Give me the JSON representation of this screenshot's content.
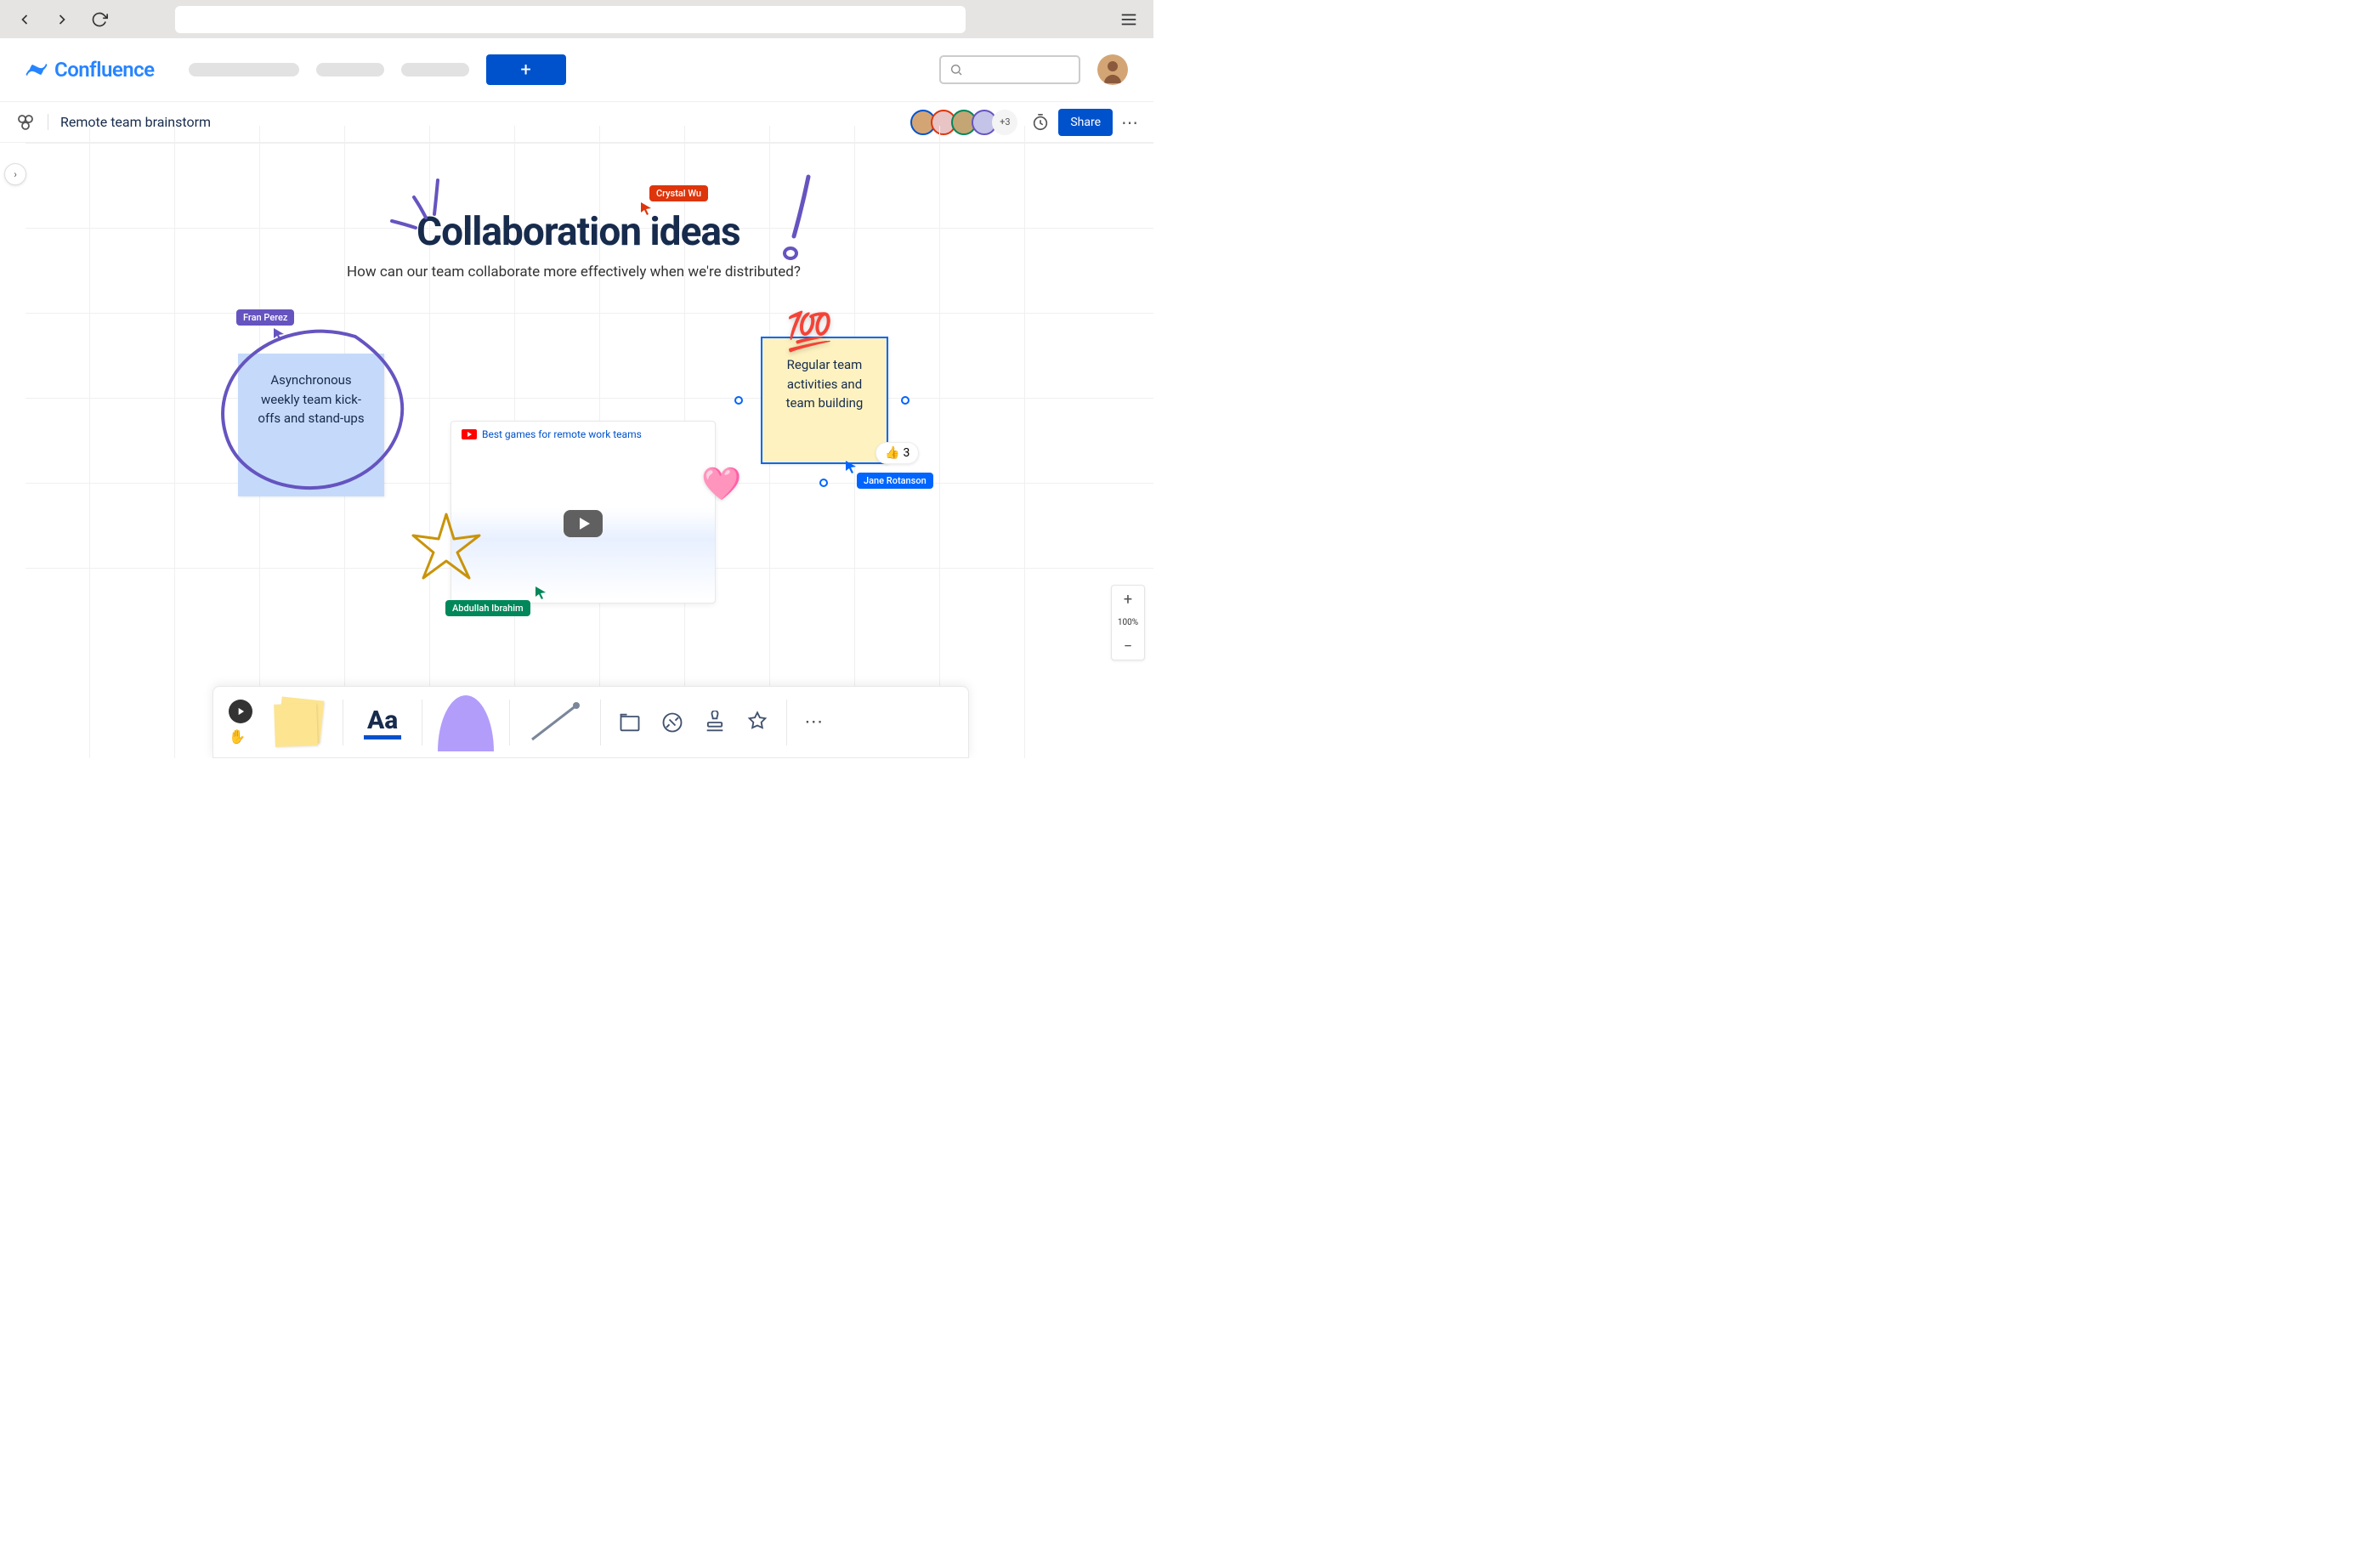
{
  "app": {
    "name": "Confluence"
  },
  "page": {
    "title": "Remote team brainstorm"
  },
  "toolbar": {
    "share": "Share",
    "more_avatars": "+3"
  },
  "canvas": {
    "title": "Collaboration ideas",
    "subtitle": "How can our team collaborate more effectively when we're distributed?"
  },
  "cursors": {
    "crystal": "Crystal Wu",
    "fran": "Fran Perez",
    "abdullah": "Abdullah Ibrahim",
    "jane": "Jane Rotanson"
  },
  "stickies": {
    "blue": "Asynchronous weekly team kick-offs and stand-ups",
    "yellow": "Regular team activities and team building"
  },
  "video": {
    "title": "Best games for remote work teams"
  },
  "reaction": {
    "emoji": "👍",
    "count": "3"
  },
  "stickers": {
    "hundred": "💯",
    "heart": "🩷"
  },
  "zoom": {
    "level": "100%"
  },
  "bottom": {
    "text_tool": "Aa"
  },
  "colors": {
    "crystal": "#DE350B",
    "fran": "#6554C0",
    "abdullah": "#00875A",
    "jane": "#0065FF"
  }
}
